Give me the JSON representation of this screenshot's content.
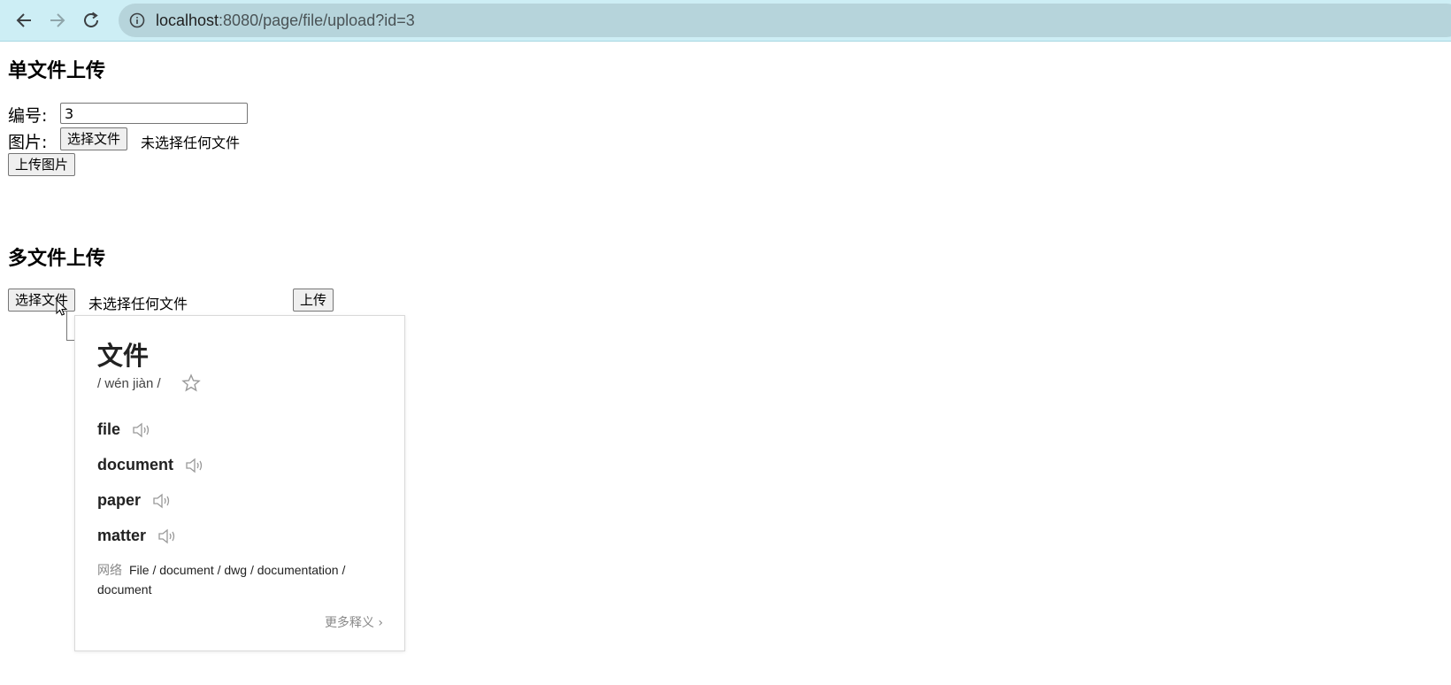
{
  "browser": {
    "url_host": "localhost",
    "url_path": ":8080/page/file/upload?id=3"
  },
  "single_upload": {
    "title": "单文件上传",
    "id_label": "编号:",
    "id_value": "3",
    "image_label": "图片:",
    "choose_file_label": "选择文件",
    "no_file_text": "未选择任何文件",
    "upload_button_label": "上传图片"
  },
  "multi_upload": {
    "title": "多文件上传",
    "choose_file_label": "选择文件",
    "no_file_text": "未选择任何文件",
    "upload_button_label": "上传"
  },
  "dictionary_popup": {
    "word": "文件",
    "pinyin": "/ wén jiàn /",
    "definitions": [
      "file",
      "document",
      "paper",
      "matter"
    ],
    "net_label": "网络",
    "net_text": "File / document / dwg / documentation / document",
    "more_label": "更多释义 ›"
  }
}
